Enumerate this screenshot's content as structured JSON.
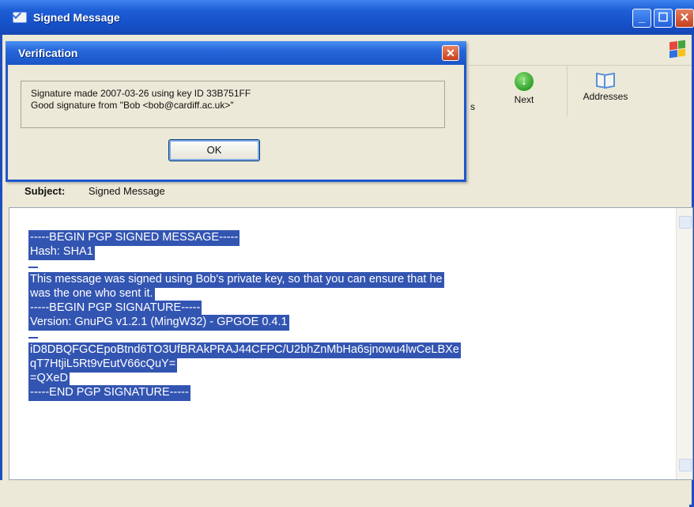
{
  "main_window": {
    "title": "Signed Message",
    "buttons": {
      "minimize": "_",
      "maximize": "☐",
      "close": "✕"
    }
  },
  "toolbar": {
    "partial_label": "s",
    "next_label": "Next",
    "addresses_label": "Addresses"
  },
  "subject": {
    "key": "Subject:",
    "value": "Signed Message"
  },
  "message_lines": [
    "-----BEGIN PGP SIGNED MESSAGE-----",
    "Hash: SHA1",
    "",
    "This message was signed using Bob's private key, so that you can ensure that he",
    "was the one who sent it.",
    "-----BEGIN PGP SIGNATURE-----",
    "Version: GnuPG v1.2.1 (MingW32) - GPGOE 0.4.1",
    "",
    "iD8DBQFGCEpoBtnd6TO3UfBRAkPRAJ44CFPC/U2bhZnMbHa6sjnowu4lwCeLBXe",
    "qT7HtjiL5Rt9vEutV66cQuY=",
    "=QXeD",
    "-----END PGP SIGNATURE-----"
  ],
  "dialog": {
    "title": "Verification",
    "close": "✕",
    "line1": "Signature made 2007-03-26 using key ID 33B751FF",
    "line2": "Good signature from \"Bob <bob@cardiff.ac.uk>\"",
    "ok_label": "OK"
  },
  "colors": {
    "title_blue": "#1e5ed6",
    "selection": "#3355b2",
    "dialog_bg": "#ece9d8"
  }
}
